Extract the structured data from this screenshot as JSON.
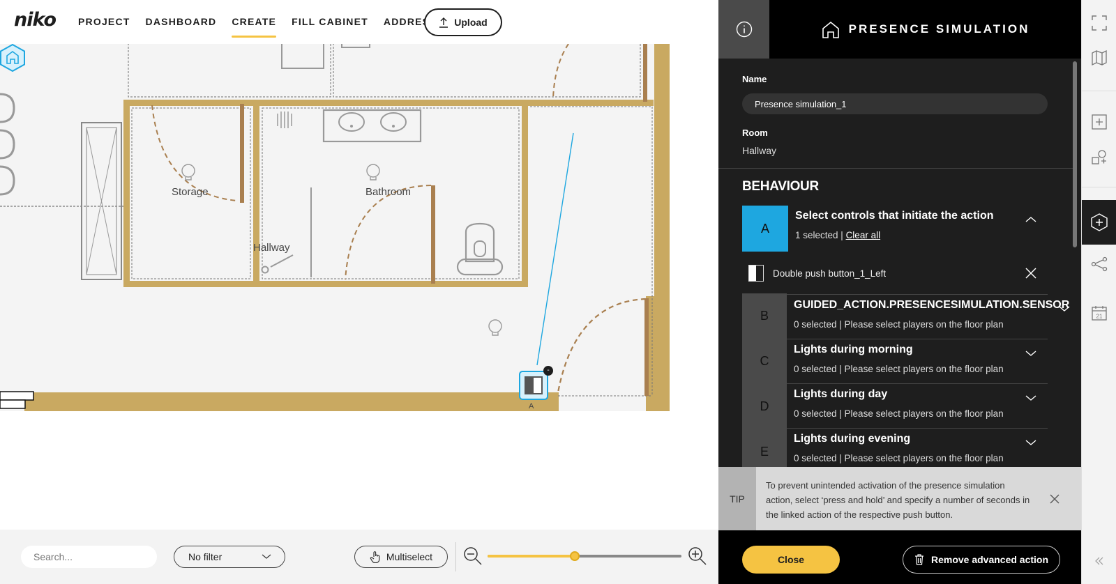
{
  "app": {
    "logo": "niko"
  },
  "nav": {
    "items": [
      {
        "label": "PROJECT"
      },
      {
        "label": "DASHBOARD"
      },
      {
        "label": "CREATE",
        "active": true
      },
      {
        "label": "FILL CABINET"
      },
      {
        "label": "ADDRESS"
      }
    ],
    "upload_label": "Upload"
  },
  "floorplan": {
    "rooms": {
      "storage": "Storage",
      "bathroom": "Bathroom",
      "hallway": "Hallway"
    },
    "control_marker_letter": "A",
    "control_badge": "-"
  },
  "toolbar": {
    "search_placeholder": "Search...",
    "filter_value": "No filter",
    "multiselect_label": "Multiselect",
    "zoom_level": 0.45
  },
  "panel": {
    "title": "PRESENCE SIMULATION",
    "name_label": "Name",
    "name_value": "Presence simulation_1",
    "room_label": "Room",
    "room_value": "Hallway",
    "behaviour_title": "BEHAVIOUR",
    "step_a": {
      "letter": "A",
      "title": "Select controls that initiate the action",
      "selected_count": "1 selected | ",
      "clear_all": "Clear all",
      "selected_item": "Double push button_1_Left"
    },
    "steps": [
      {
        "letter": "B",
        "title": "GUIDED_ACTION.PRESENCESIMULATION.SENSOR",
        "sub": "0 selected | Please select players on the floor plan"
      },
      {
        "letter": "C",
        "title": "Lights during morning",
        "sub": "0 selected | Please select players on the floor plan"
      },
      {
        "letter": "D",
        "title": "Lights during day",
        "sub": "0 selected | Please select players on the floor plan"
      },
      {
        "letter": "E",
        "title": "Lights during evening",
        "sub": "0 selected | Please select players on the floor plan"
      }
    ],
    "tip_label": "TIP",
    "tip_text": "To prevent unintended activation of the presence simulation action, select ‘press and hold’ and specify a number of seconds in the linked action of the respective push button.",
    "close_label": "Close",
    "remove_label": "Remove advanced action"
  },
  "rail": {
    "calendar_day": "21"
  },
  "colors": {
    "accent": "#f5c342",
    "panel_bg": "#1e1e1e",
    "highlight": "#1ea7e0",
    "wall": "#c9a961",
    "door": "#a97f4f"
  }
}
